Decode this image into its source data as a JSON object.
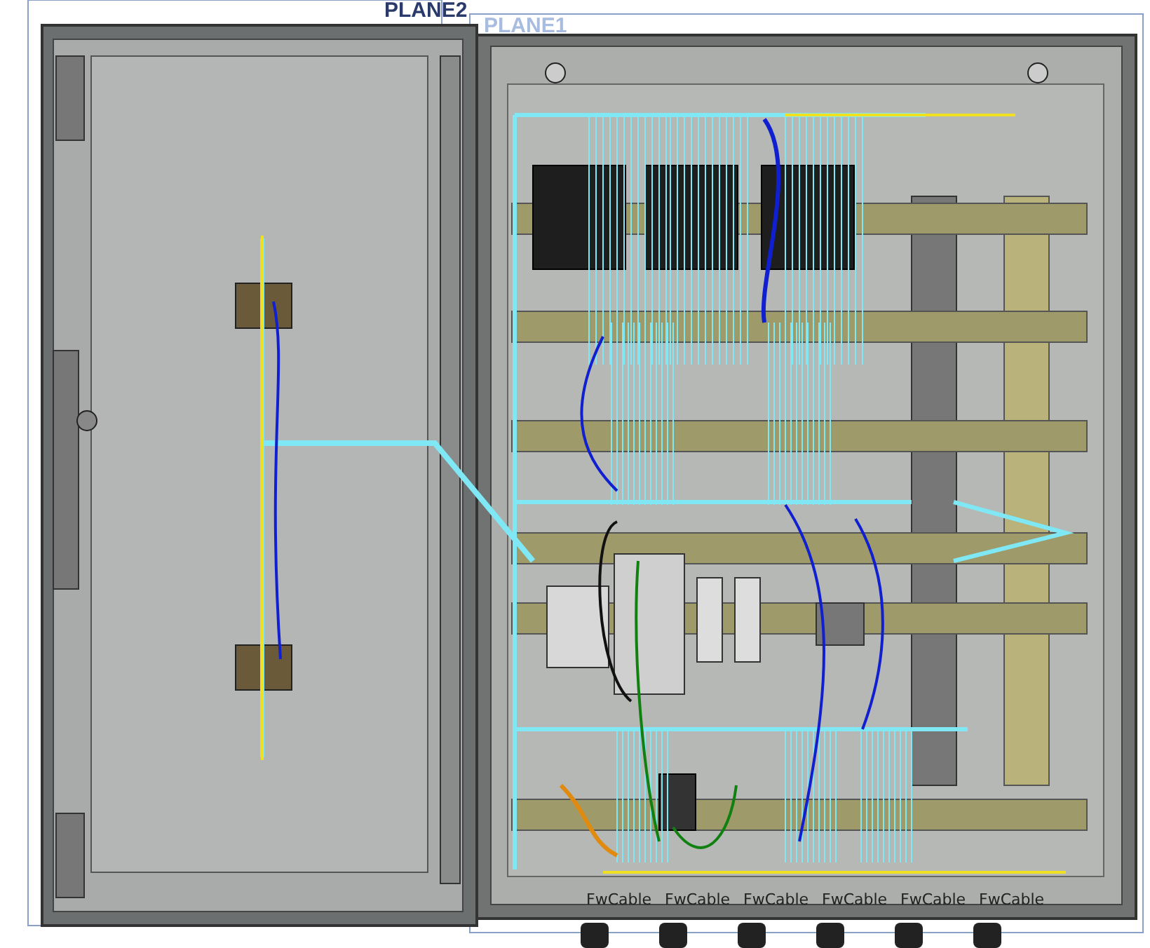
{
  "viewport": {
    "plane_labels": [
      {
        "text": "PLANE2",
        "kind": "active"
      },
      {
        "text": "PLANE1",
        "kind": "faded"
      }
    ],
    "cable_labels": [
      "FwCable",
      "FwCable",
      "FwCable",
      "FwCable",
      "FwCable",
      "FwCable"
    ]
  }
}
